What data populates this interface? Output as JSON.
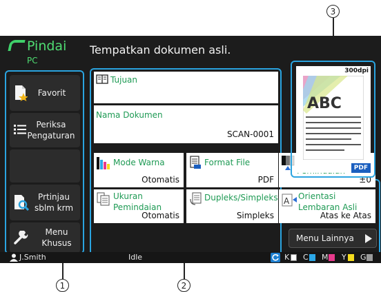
{
  "callouts": [
    "1",
    "2",
    "3"
  ],
  "app": {
    "title": "Pindai",
    "subtitle": "PC"
  },
  "header": {
    "message": "Tempatkan dokumen asli."
  },
  "sidebar": {
    "items": [
      {
        "label": "Favorit",
        "icon": "favorite-document-icon"
      },
      {
        "label": "Periksa Pengaturan",
        "icon": "list-icon"
      },
      {
        "label": "Prtinjau sblm krm",
        "icon": "preview-magnifier-icon"
      },
      {
        "label": "Menu Khusus",
        "icon": "wrench-icon"
      }
    ]
  },
  "destination": {
    "label": "Tujuan",
    "icon": "address-book-icon"
  },
  "document_name": {
    "label": "Nama Dokumen",
    "value": "SCAN-0001"
  },
  "settings": [
    {
      "label": "Mode Warna",
      "value": "Otomatis",
      "icon": "color-mode-icon"
    },
    {
      "label": "Format File",
      "value": "PDF",
      "icon": "file-format-icon"
    },
    {
      "label": "Tingkat Pemindaian",
      "value": "±0",
      "icon": "scan-level-icon"
    },
    {
      "label": "Ukuran Pemindaian",
      "value": "Otomatis",
      "icon": "scan-size-icon"
    },
    {
      "label": "Dupleks/Simpleks",
      "value": "Simpleks",
      "icon": "duplex-icon"
    },
    {
      "label": "Orientasi Lembaran Asli",
      "value": "Atas ke Atas",
      "icon": "orientation-icon"
    }
  ],
  "preview": {
    "resolution": "300dpi",
    "badge": "PDF",
    "sample_text": "ABC"
  },
  "more_button": {
    "label": "Menu Lainnya"
  },
  "status_bar": {
    "user": "J.Smith",
    "state": "Idle",
    "toner": [
      {
        "label": "K",
        "color": "#ffffff"
      },
      {
        "label": "C",
        "color": "#2ca8e8"
      },
      {
        "label": "M",
        "color": "#e83a8c"
      },
      {
        "label": "Y",
        "color": "#f5dc1e"
      },
      {
        "label": "G",
        "color": "#9a9a9a"
      }
    ]
  },
  "colors": {
    "accent": "#2aa4e0",
    "brand_green": "#4fdc72",
    "label_green": "#1e9a54"
  }
}
